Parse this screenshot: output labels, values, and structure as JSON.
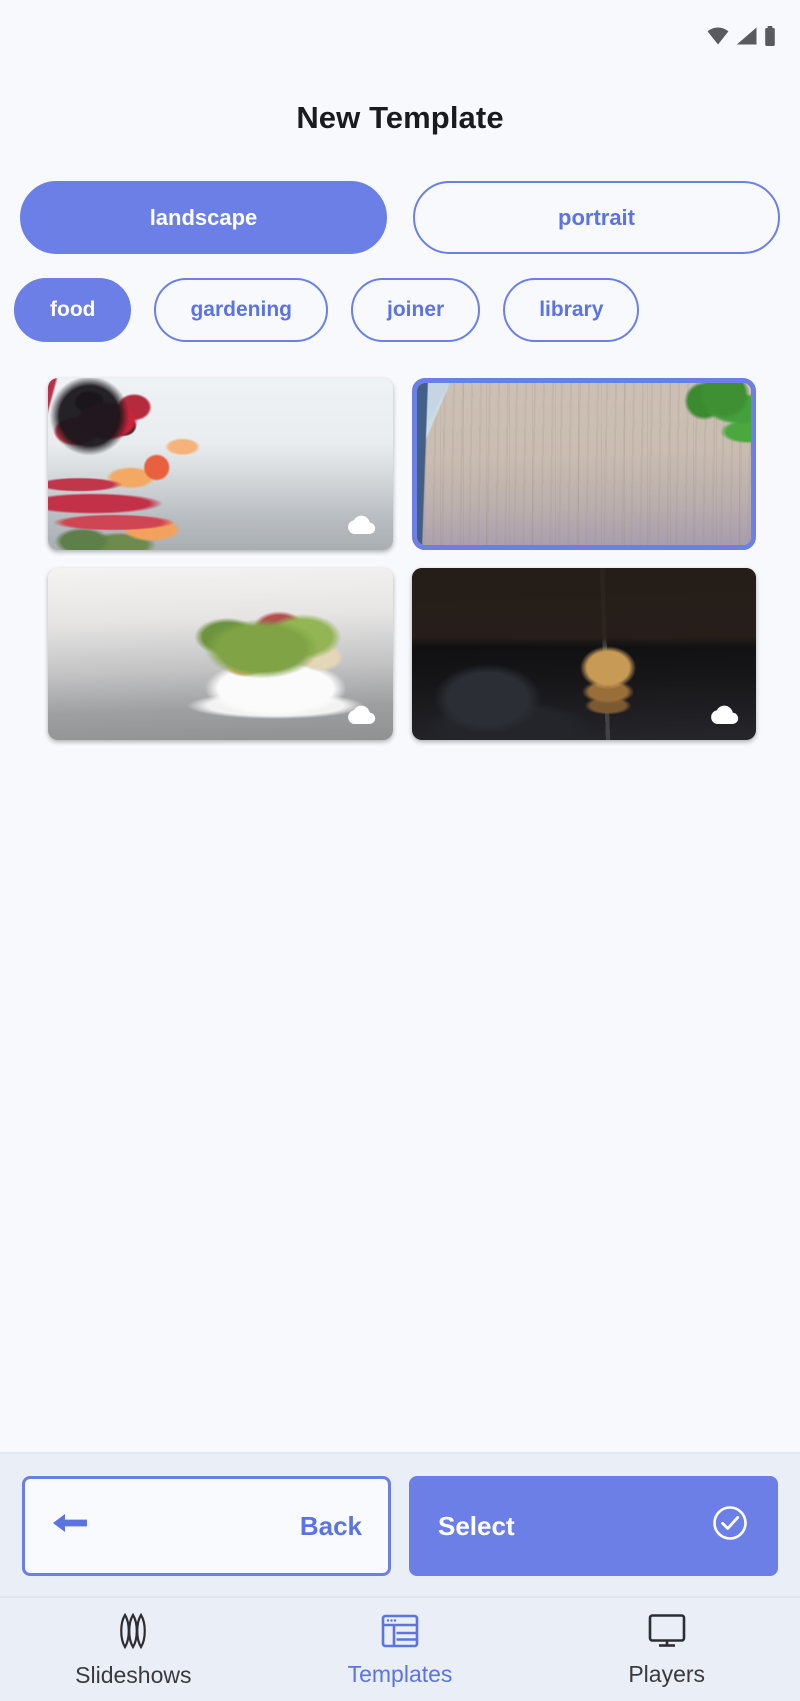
{
  "status_bar": {
    "icons": [
      "wifi-icon",
      "cellular-signal-icon",
      "battery-icon"
    ]
  },
  "header": {
    "title": "New Template"
  },
  "orientation": {
    "options": [
      {
        "label": "landscape",
        "selected": true
      },
      {
        "label": "portrait",
        "selected": false
      }
    ]
  },
  "categories": {
    "chips": [
      {
        "label": "food",
        "selected": true
      },
      {
        "label": "gardening",
        "selected": false
      },
      {
        "label": "joiner",
        "selected": false
      },
      {
        "label": "library",
        "selected": false
      }
    ]
  },
  "templates": {
    "items": [
      {
        "name": "berries-and-rhubarb-template",
        "art": "art-berries",
        "selected": false,
        "cloud_badge": true
      },
      {
        "name": "wood-board-herbs-template",
        "art": "art-wood",
        "selected": true,
        "cloud_badge": false
      },
      {
        "name": "salad-bowl-template",
        "art": "art-salad",
        "selected": false,
        "cloud_badge": true
      },
      {
        "name": "dark-burger-template",
        "art": "art-burger",
        "selected": false,
        "cloud_badge": true
      }
    ]
  },
  "actions": {
    "back_label": "Back",
    "back_icon": "arrow-left-icon",
    "select_label": "Select",
    "select_icon": "check-circle-icon"
  },
  "bottom_nav": {
    "items": [
      {
        "label": "Slideshows",
        "icon": "layers-wave-icon",
        "active": false
      },
      {
        "label": "Templates",
        "icon": "layout-window-icon",
        "active": true
      },
      {
        "label": "Players",
        "icon": "monitor-icon",
        "active": false
      }
    ]
  },
  "colors": {
    "accent": "#6b7fe6",
    "accent_text": "#5b74e0",
    "page_background": "#f7f9fc",
    "bar_background": "#eaeef7",
    "title_text": "#1b1b1f",
    "nav_text": "#3a3a3e"
  }
}
